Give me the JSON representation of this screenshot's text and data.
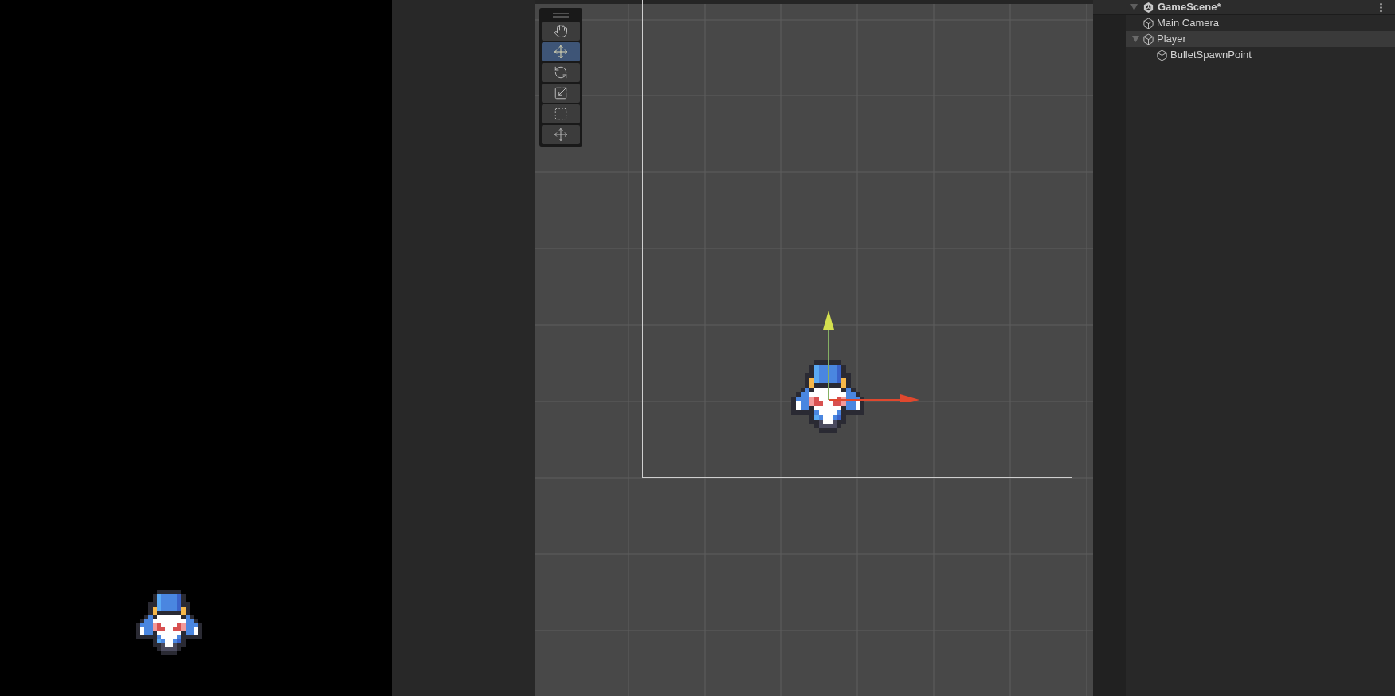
{
  "scene_view": {
    "tools": [
      {
        "kind": "hand",
        "selected": false
      },
      {
        "kind": "move",
        "selected": true
      },
      {
        "kind": "rotate",
        "selected": false
      },
      {
        "kind": "scale",
        "selected": false
      },
      {
        "kind": "rect",
        "selected": false
      },
      {
        "kind": "transform",
        "selected": false
      }
    ]
  },
  "hierarchy": {
    "items": [
      {
        "label": "GameScene*",
        "kind": "scene",
        "expanded": true,
        "selected": false,
        "children": [
          {
            "label": "Main Camera",
            "kind": "object",
            "selected": false
          },
          {
            "label": "Player",
            "kind": "object",
            "expanded": true,
            "selected": true,
            "children": [
              {
                "label": "BulletSpawnPoint",
                "kind": "object",
                "selected": false
              }
            ]
          }
        ]
      }
    ]
  }
}
